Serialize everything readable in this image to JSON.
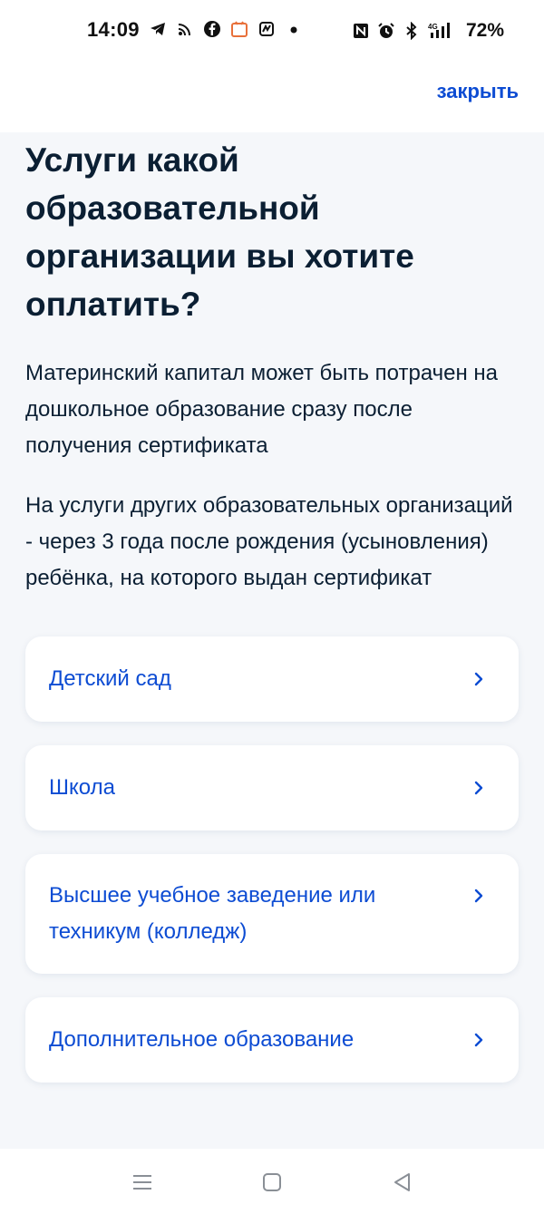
{
  "status_bar": {
    "time": "14:09",
    "battery": "72%",
    "left_icons": [
      "telegram-icon",
      "cast-icon",
      "facebook-icon",
      "calendar-icon",
      "app-icon",
      "dot-icon"
    ],
    "right_icons": [
      "nfc-icon",
      "alarm-icon",
      "bluetooth-icon",
      "signal-4g-icon"
    ]
  },
  "header": {
    "close_label": "закрыть"
  },
  "main": {
    "title": "Услуги какой образовательной организации вы хотите оплатить?",
    "description_1": "Материнский капитал может быть потрачен на дошкольное образование сразу после получения сертификата",
    "description_2": "На услуги других образовательных организаций - через 3 года после рождения (усыновления) ребёнка, на которого выдан сертификат",
    "options": [
      {
        "label": "Детский сад"
      },
      {
        "label": "Школа"
      },
      {
        "label": "Высшее учебное заведение или техникум (колледж)"
      },
      {
        "label": "Дополнительное образование"
      }
    ]
  },
  "nav_bar": {
    "icons": [
      "menu-icon",
      "home-icon",
      "back-icon"
    ]
  },
  "colors": {
    "accent": "#0d4cd3",
    "text": "#0b1f33",
    "background": "#f5f7fa",
    "card": "#ffffff"
  }
}
